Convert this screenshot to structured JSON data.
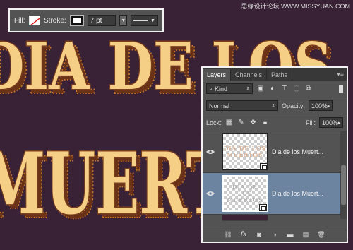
{
  "canvas": {
    "line1": "DIA DE LOS",
    "line2": "MUERTOS",
    "background_color": "#3a2236",
    "text_color": "#f6cf86",
    "outline_color": "#7a3e1e"
  },
  "watermark": "思缘设计论坛 WWW.MISSYUAN.COM",
  "options_bar": {
    "fill_label": "Fill:",
    "stroke_label": "Stroke:",
    "stroke_width": "7 pt",
    "fill_icon": "no-fill-swatch",
    "stroke_icon": "stroke-color-swatch"
  },
  "layers_panel": {
    "tabs": [
      {
        "label": "Layers",
        "active": true
      },
      {
        "label": "Channels",
        "active": false
      },
      {
        "label": "Paths",
        "active": false
      }
    ],
    "filter": {
      "label": "Kind"
    },
    "blend_mode": "Normal",
    "opacity_label": "Opacity:",
    "opacity_value": "100%",
    "lock_label": "Lock:",
    "fill_label": "Fill:",
    "fill_value": "100%",
    "layers": [
      {
        "name": "Dia de los Muert...",
        "thumb_line1": "DIA DE LOS",
        "thumb_line2": "MUERTOS",
        "selected": false,
        "visible": true
      },
      {
        "name": "Dia de los Muert...",
        "thumb_line1": "DIA DE LOS",
        "thumb_line2": "MUERTOS",
        "selected": true,
        "visible": true
      }
    ],
    "accent_color": "#6d84a0"
  }
}
